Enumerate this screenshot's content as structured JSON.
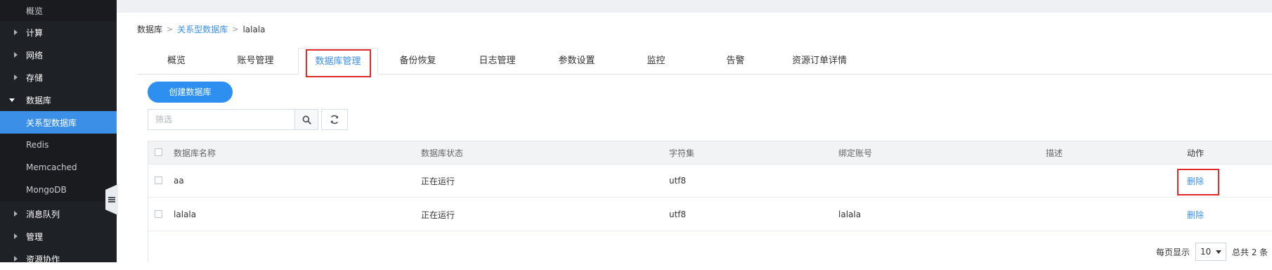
{
  "sidebar": {
    "items": [
      {
        "label": "概览",
        "type": "sub"
      },
      {
        "label": "计算",
        "type": "group"
      },
      {
        "label": "网络",
        "type": "group"
      },
      {
        "label": "存储",
        "type": "group"
      },
      {
        "label": "数据库",
        "type": "group-open"
      },
      {
        "label": "关系型数据库",
        "type": "active"
      },
      {
        "label": "Redis",
        "type": "sub"
      },
      {
        "label": "Memcached",
        "type": "sub"
      },
      {
        "label": "MongoDB",
        "type": "sub"
      },
      {
        "label": "消息队列",
        "type": "group"
      },
      {
        "label": "管理",
        "type": "group"
      },
      {
        "label": "资源协作",
        "type": "group"
      }
    ]
  },
  "breadcrumb": {
    "root": "数据库",
    "section": "关系型数据库",
    "current": "lalala",
    "separator": ">"
  },
  "tabs": [
    {
      "label": "概览"
    },
    {
      "label": "账号管理"
    },
    {
      "label": "数据库管理",
      "active": true
    },
    {
      "label": "备份恢复"
    },
    {
      "label": "日志管理"
    },
    {
      "label": "参数设置"
    },
    {
      "label": "监控"
    },
    {
      "label": "告警"
    },
    {
      "label": "资源订单详情"
    }
  ],
  "toolbar": {
    "create_label": "创建数据库",
    "search_placeholder": "筛选"
  },
  "table": {
    "columns": [
      "数据库名称",
      "数据库状态",
      "字符集",
      "绑定账号",
      "描述",
      "动作"
    ],
    "rows": [
      {
        "name": "aa",
        "status": "正在运行",
        "charset": "utf8",
        "account": "",
        "desc": "",
        "action": "删除"
      },
      {
        "name": "lalala",
        "status": "正在运行",
        "charset": "utf8",
        "account": "lalala",
        "desc": "",
        "action": "删除"
      }
    ]
  },
  "pagination": {
    "per_page_label": "每页显示",
    "per_page_value": "10",
    "total_label": "总共 2 条"
  },
  "colors": {
    "accent": "#3b8fe6",
    "highlight": "#e02a2a",
    "sidebar_bg": "#1e2125"
  }
}
